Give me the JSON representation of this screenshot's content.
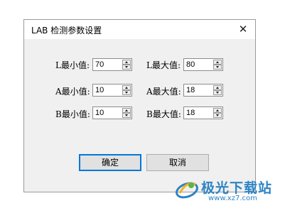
{
  "dialog": {
    "title": "LAB 检测参数设置",
    "close_icon": "close-icon"
  },
  "fields": {
    "l_min": {
      "label": "L最小值:",
      "value": "70"
    },
    "l_max": {
      "label": "L最大值:",
      "value": "80"
    },
    "a_min": {
      "label": "A最小值:",
      "value": "10"
    },
    "a_max": {
      "label": "A最大值:",
      "value": "18"
    },
    "b_min": {
      "label": "B最小值:",
      "value": "10"
    },
    "b_max": {
      "label": "B最大值:",
      "value": "18"
    }
  },
  "buttons": {
    "ok_label": "确定",
    "cancel_label": "取消"
  },
  "watermark": {
    "text": "极光下载站",
    "url": "www.xz7.com"
  },
  "colors": {
    "accent": "#0078d7",
    "watermark": "#2e84c4"
  }
}
